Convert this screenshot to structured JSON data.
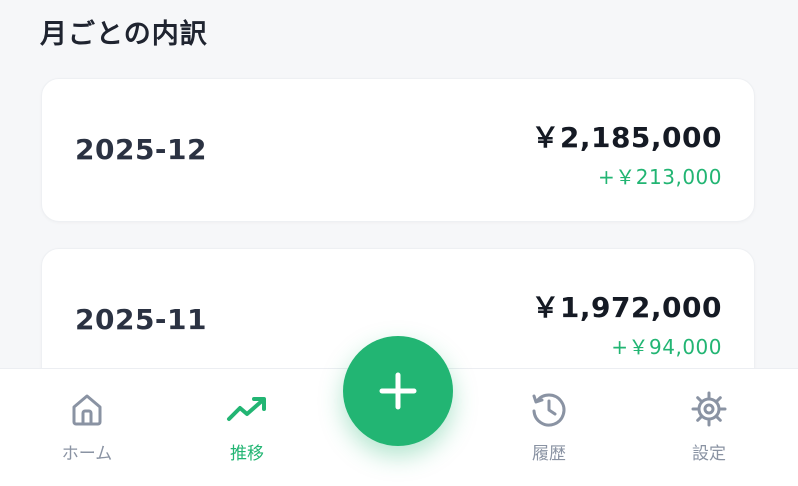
{
  "section_title": "月ごとの内訳",
  "months": [
    {
      "month": "2025-12",
      "total": "￥2,185,000",
      "change": "+￥213,000"
    },
    {
      "month": "2025-11",
      "total": "￥1,972,000",
      "change": "+￥94,000"
    }
  ],
  "nav": {
    "home": {
      "label": "ホーム",
      "icon": "home-icon"
    },
    "trend": {
      "label": "推移",
      "icon": "trend-icon",
      "active": true
    },
    "add": {
      "icon": "plus-icon"
    },
    "history": {
      "label": "履歴",
      "icon": "history-icon"
    },
    "settings": {
      "label": "設定",
      "icon": "gear-icon"
    }
  },
  "colors": {
    "accent": "#22b573",
    "inactive": "#8a93a3",
    "text": "#1f2430",
    "background": "#f6f7f9"
  }
}
